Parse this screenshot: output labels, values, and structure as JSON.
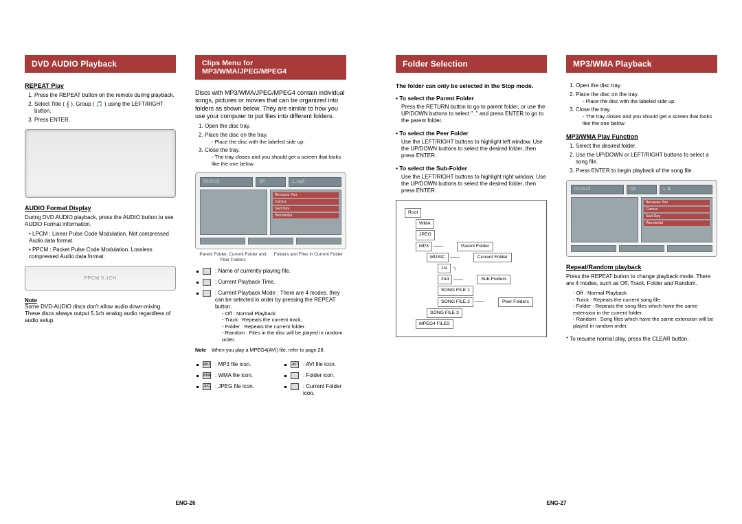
{
  "leftPage": {
    "footer": "ENG-26",
    "col1": {
      "header": "DVD AUDIO Playback",
      "repeat": {
        "title": "REPEAT Play",
        "steps": [
          "Press the REPEAT button on the remote during playback.",
          "Select Title ( 𝄞 ), Group ( 🎵 ) using the LEFT/RIGHT button.",
          "Press ENTER."
        ]
      },
      "audioFormat": {
        "title": "AUDIO Format Display",
        "intro": "During DVD AUDIO playback, press the AUDIO button to see AUDIO Format information.",
        "items": [
          {
            "prefix": "LPCM : ",
            "body": "Linear Pulse Code Modulation. Not compressed Audio data format."
          },
          {
            "prefix": "PPCM : ",
            "body": "Packet Pulse Code Modulation. Lossless compressed Audio data format."
          }
        ],
        "barLabel": "PPCM 5.1CH"
      },
      "note": {
        "label": "Note",
        "text": "Some DVD-AUDIO discs don't allow audio down-mixing. These discs always output 5.1ch analog audio regardless of audio setup."
      }
    },
    "col2": {
      "header": "Clips Menu for MP3/WMA/JPEG/MPEG4",
      "intro": "Discs with MP3/WMA/JPEG/MPEG4 contain individual songs, pictures or movies that can be organized into folders as shown below. They are similar to how you use your computer to put files into different folders.",
      "steps": [
        "Open the disc tray.",
        "Place the disc on the tray.",
        "Close the tray."
      ],
      "stepSubs": {
        "1": "- Place the disc with the labeled side up.",
        "2": "- The tray closes and you should get a screen that looks like the one below."
      },
      "clipsTop": [
        "00:00:23",
        "Off",
        "1..mp3"
      ],
      "clipsItems": [
        "Because You",
        "Cactus",
        "Sad Day",
        "Wonderful"
      ],
      "captionLeft": "Parent Folder, Current Folder and Peer Folders",
      "captionRight": "Folders and Files in Current Folder",
      "infoRows": [
        ": Name of currently playing file.",
        ": Current Playback Time.",
        ": Current Playback Mode : There are 4 modes. they can be selected in order by pressing the REPEAT button."
      ],
      "modes": [
        "- Off : Normal Playback",
        "- Track : Repeats the current track.",
        "- Folder : Repeats the current folder.",
        "- Random : Files in the disc will be played in random order."
      ],
      "note": {
        "label": "Note",
        "text": "When you play a MPEG4(AVI) file, refer to page 28."
      },
      "iconsLeft": [
        {
          "abbr": "MP3",
          "text": ": MP3 file icon."
        },
        {
          "abbr": "WMA",
          "text": ": WMA file icon."
        },
        {
          "abbr": "JPG",
          "text": ": JPEG file icon."
        }
      ],
      "iconsRight": [
        {
          "abbr": "AVI",
          "text": ": AVI file icon."
        },
        {
          "abbr": "",
          "text": ": Folder icon."
        },
        {
          "abbr": "",
          "text": ": Current Folder icon."
        }
      ]
    }
  },
  "rightPage": {
    "footer": "ENG-27",
    "col1": {
      "header": "Folder Selection",
      "intro": "The folder can only be selected in the Stop mode.",
      "groups": [
        {
          "title": "• To select the Parent Folder",
          "body": "Press the RETURN button to go to parent folder, or use the UP/DOWN buttons to select \"..\" and press ENTER to go to the parent folder."
        },
        {
          "title": "• To select the Peer Folder",
          "body": "Use the LEFT/RIGHT buttons to highlight left window. Use the UP/DOWN buttons to select the desired folder, then press ENTER."
        },
        {
          "title": "• To select the Sub-Folder",
          "body": "Use the LEFT/RIGHT buttons to highlight right window. Use the UP/DOWN buttons to select the desired folder, then press ENTER."
        }
      ],
      "diagram": {
        "root": "Root",
        "wma": "WMA",
        "jpeg": "JPEG",
        "mp3": "MP3",
        "music": "MUSIC",
        "first": "1st",
        "second": "2nd",
        "sf1": "SONG FILE 1",
        "sf2": "SONG FILE 2",
        "sf3": "SONG FILE 3",
        "mpeg": "MPEG4 FILES",
        "parent": "Parent Folder",
        "current": "Current Folder",
        "sub": "Sub-Folders",
        "peer": "Peer Folders"
      }
    },
    "col2": {
      "header": "MP3/WMA Playback",
      "steps": [
        "Open the disc tray.",
        "Place the disc on the tray.",
        "Close the tray."
      ],
      "stepSubs": {
        "1": "- Place the disc with the labeled side up.",
        "2": "- The tray closes and you should get a screen that looks like the one below."
      },
      "func": {
        "title": "MP3/WMA Play Function",
        "steps": [
          "Select the desired folder.",
          "Use the UP/DOWN or LEFT/RIGHT buttons to select a song file.",
          "Press ENTER to begin playback of the song file."
        ]
      },
      "clipsTop": [
        "00:00:23",
        "Off",
        "1..B.."
      ],
      "clipsItems": [
        "Because You",
        "Cactus",
        "Sad Day",
        "Wonderful"
      ],
      "repeat": {
        "title": "Repeat/Random playback",
        "body": "Press the REPEAT button to change playback mode. There are 4 modes, such as Off, Track, Folder and Random.",
        "modes": [
          "- Off : Normal Playback",
          "- Track : Repeats the current song file.",
          "- Folder : Repeats the song files which have the same extension in the current folder.",
          "- Random : Song files which have the same extension will be played in random order."
        ],
        "resume": "* To resume normal play, press the CLEAR button."
      }
    }
  }
}
